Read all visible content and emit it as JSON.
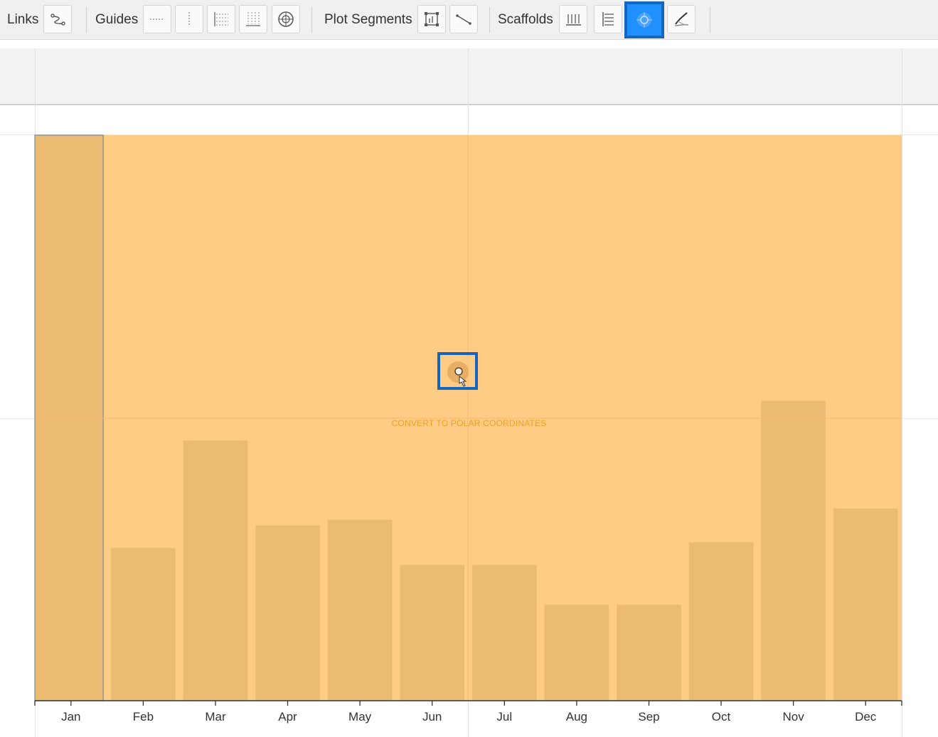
{
  "toolbar": {
    "links_label": "Links",
    "guides_label": "Guides",
    "plot_segments_label": "Plot Segments",
    "scaffolds_label": "Scaffolds",
    "icons": {
      "links": "link-tool-icon",
      "guide_horizontal": "horizontal-guide-icon",
      "guide_vertical": "vertical-guide-icon",
      "guide_x_grid": "x-grid-guide-icon",
      "guide_y_grid": "y-grid-guide-icon",
      "guide_polar": "polar-guide-icon",
      "plot_segment_2d": "2d-region-icon",
      "plot_segment_line": "line-segment-icon",
      "scaffold_horizontal": "horizontal-scaffold-icon",
      "scaffold_vertical": "vertical-scaffold-icon",
      "scaffold_polar": "polar-scaffold-icon",
      "scaffold_curve": "curve-scaffold-icon"
    },
    "active_tool": "scaffold_polar"
  },
  "canvas": {
    "drop_hint": "CONVERT TO POLAR COORDINATES",
    "region_color": "#ffcc85",
    "bar_color": "#ebbb74",
    "hint_color": "#f0a020",
    "accent_color": "#1565c0"
  },
  "chart_data": {
    "type": "bar",
    "categories": [
      "Jan",
      "Feb",
      "Mar",
      "Apr",
      "May",
      "Jun",
      "Jul",
      "Aug",
      "Sep",
      "Oct",
      "Nov",
      "Dec"
    ],
    "values": [
      100,
      27,
      46,
      31,
      32,
      24,
      24,
      17,
      17,
      28,
      53,
      34
    ],
    "ylim": [
      0,
      100
    ],
    "title": "",
    "xlabel": "",
    "ylabel": "",
    "grid": false,
    "selected_category": "Jan"
  }
}
